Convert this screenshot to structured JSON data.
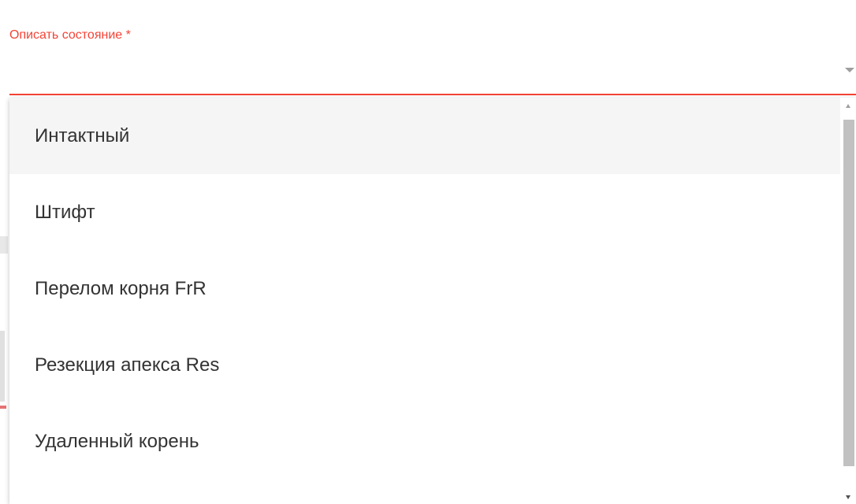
{
  "field": {
    "label": "Описать состояние *",
    "value": "",
    "accent_color": "#f44336"
  },
  "dropdown": {
    "items": [
      {
        "label": "Интактный",
        "highlighted": true
      },
      {
        "label": "Штифт",
        "highlighted": false
      },
      {
        "label": "Перелом корня FrR",
        "highlighted": false
      },
      {
        "label": "Резекция апекса Res",
        "highlighted": false
      },
      {
        "label": "Удаленный корень",
        "highlighted": false
      }
    ]
  },
  "icons": {
    "caret": "caret-down-icon",
    "scroll_up": "scroll-up-icon",
    "scroll_down": "scroll-down-icon"
  }
}
